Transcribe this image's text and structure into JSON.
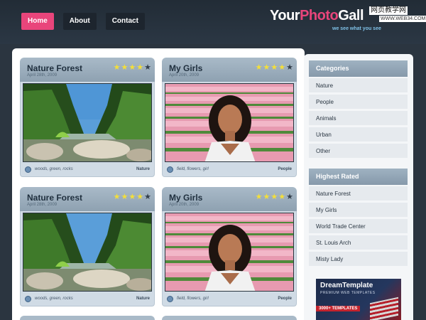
{
  "nav": {
    "items": [
      {
        "label": "Home",
        "active": true
      },
      {
        "label": "About",
        "active": false
      },
      {
        "label": "Contact",
        "active": false
      }
    ]
  },
  "logo": {
    "part1": "Your",
    "part2": "Photo",
    "part3": "Gall",
    "tagline": "we see what you see"
  },
  "watermark": {
    "line1": "网页教学网",
    "line2": "WWW.WEB34.COM"
  },
  "colors": {
    "accent": "#e9457b",
    "star": "#f4df3a",
    "header": "#222c36"
  },
  "cards": [
    {
      "title": "Nature Forest",
      "date": "April 28th, 2009",
      "rating": 4,
      "max_rating": 5,
      "tags": "woods, green, rocks",
      "category": "Nature",
      "image": "forest-river"
    },
    {
      "title": "My Girls",
      "date": "April 20th, 2009",
      "rating": 4,
      "max_rating": 5,
      "tags": "field, flowers, girl",
      "category": "People",
      "image": "girl-tulips"
    },
    {
      "title": "Nature Forest",
      "date": "April 28th, 2009",
      "rating": 4,
      "max_rating": 5,
      "tags": "woods, green, rocks",
      "category": "Nature",
      "image": "forest-river"
    },
    {
      "title": "My Girls",
      "date": "April 20th, 2009",
      "rating": 4,
      "max_rating": 5,
      "tags": "field, flowers, girl",
      "category": "People",
      "image": "girl-tulips"
    }
  ],
  "sidebar": {
    "categories_title": "Categories",
    "categories": [
      "Nature",
      "People",
      "Animals",
      "Urban",
      "Other"
    ],
    "highest_title": "Highest Rated",
    "highest": [
      "Nature Forest",
      "My Girls",
      "World Trade Center",
      "St. Louis Arch",
      "Misty Lady"
    ],
    "ad": {
      "title": "DreamTemplate",
      "subtitle": "PREMIUM WEB TEMPLATES",
      "count": "3000+ TEMPLATES"
    }
  }
}
